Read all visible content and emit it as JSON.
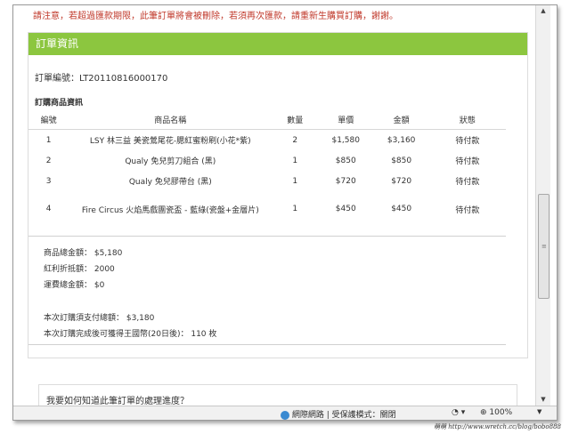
{
  "notice": "請注意，若超過匯款期限，此筆訂單將會被刪除，若須再次匯款，請重新生購買訂購，謝謝。",
  "panel": {
    "title": "訂單資訊",
    "order_number": "訂單編號：LT20110816000170",
    "section_title": "訂購商品資訊"
  },
  "table": {
    "headers": [
      "編號",
      "商品名稱",
      "數量",
      "單價",
      "金額",
      "狀態"
    ],
    "rows": [
      {
        "idx": "1",
        "name": "LSY 林三益 美瓷鶯尾花-腮紅蜜粉刷(小花*紫)",
        "qty": "2",
        "price": "$1,580",
        "amount": "$3,160",
        "status": "待付款"
      },
      {
        "idx": "2",
        "name": "Qualy 免兒剪刀組合 (黑)",
        "qty": "1",
        "price": "$850",
        "amount": "$850",
        "status": "待付款"
      },
      {
        "idx": "3",
        "name": "Qualy 免兒膠帶台 (黑)",
        "qty": "1",
        "price": "$720",
        "amount": "$720",
        "status": "待付款"
      },
      {
        "idx": "4",
        "name": "Fire Circus 火焰馬戲團瓷盃 - 藍綠(瓷盤+金層片)",
        "qty": "1",
        "price": "$450",
        "amount": "$450",
        "status": "待付款"
      }
    ]
  },
  "summary": {
    "goods_total": "商品總金額： $5,180",
    "bonus_discount": "紅利折抵額： 2000",
    "shipping_total": "運費總金額： $0",
    "pay_total": "本次訂購須支付總額： $3,180",
    "points_earned": "本次訂購完成後可獲得王國幣(20日後)： 110 枚"
  },
  "bottom_panel": {
    "question": "我要如何知道此筆訂單的處理進度？"
  },
  "statusbar": {
    "zone": "網際網路 | 受保護模式：關閉",
    "zoom": "100%"
  },
  "watermark": "萌萌 http://www.wretch.cc/blog/bobo888",
  "colors": {
    "panel_header": "#8cc63f",
    "notice_text": "#c0392b"
  }
}
